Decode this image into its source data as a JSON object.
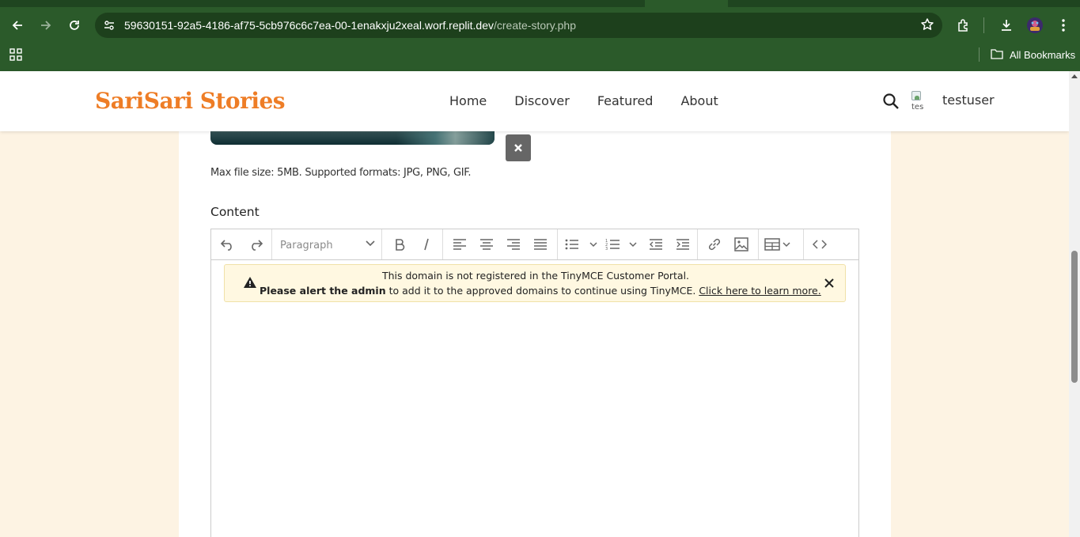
{
  "browser": {
    "url_host": "59630151-92a5-4186-af75-5cb976c6c7ea-00-1enakxju2xeal.worf.replit.dev",
    "url_path": "/create-story.php",
    "bookmarks_label": "All Bookmarks"
  },
  "header": {
    "brand": "SariSari Stories",
    "nav": [
      "Home",
      "Discover",
      "Featured",
      "About"
    ],
    "username": "testuser",
    "avatar_alt": "tes"
  },
  "form": {
    "file_help": "Max file size: 5MB. Supported formats: JPG, PNG, GIF.",
    "content_label": "Content"
  },
  "editor": {
    "block_format": "Paragraph",
    "notice": {
      "line1": "This domain is not registered in the TinyMCE Customer Portal.",
      "line2_bold": "Please alert the admin",
      "line2_rest": " to add it to the approved domains to continue using TinyMCE. ",
      "link": "Click here to learn more."
    }
  },
  "colors": {
    "brand": "#ee7d26",
    "chrome": "#2b5a2a",
    "page_bg": "#fdf3e3"
  }
}
